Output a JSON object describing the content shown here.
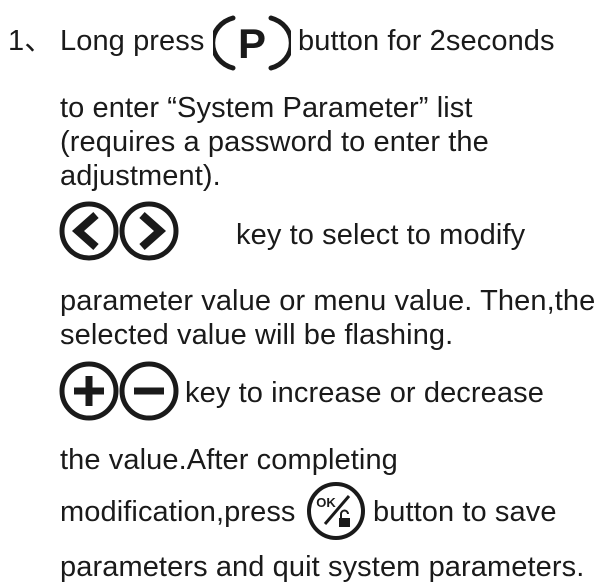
{
  "step": {
    "number": "1",
    "separator": "、",
    "segments": {
      "long_press": "Long press",
      "button_for_2seconds": "button for 2seconds",
      "enter_line": "to enter “System Parameter” list",
      "requires_line": "(requires a password to enter  the",
      "adjustment_line": "adjustment).",
      "select_key_text": "key to select to modify",
      "parameter_line": "parameter value or menu value. Then,the",
      "selected_line": "selected value will be flashing.",
      "incdec_key_text": "key to increase or decrease",
      "value_line": "the value.After completing",
      "modification_text": "modification,press",
      "save_text": "button to save",
      "quit_line": "parameters and quit system parameters."
    }
  },
  "icons": {
    "p_button": {
      "name": "p-button-icon",
      "glyph": "P"
    },
    "left_key": {
      "name": "left-arrow-icon"
    },
    "right_key": {
      "name": "right-arrow-icon"
    },
    "plus_key": {
      "name": "plus-icon"
    },
    "minus_key": {
      "name": "minus-icon"
    },
    "ok_button": {
      "name": "ok-unlock-icon",
      "glyph": "OK"
    }
  },
  "colors": {
    "text": "#1a1a1a",
    "icon_stroke": "#1a1a1a",
    "background": "#ffffff"
  }
}
